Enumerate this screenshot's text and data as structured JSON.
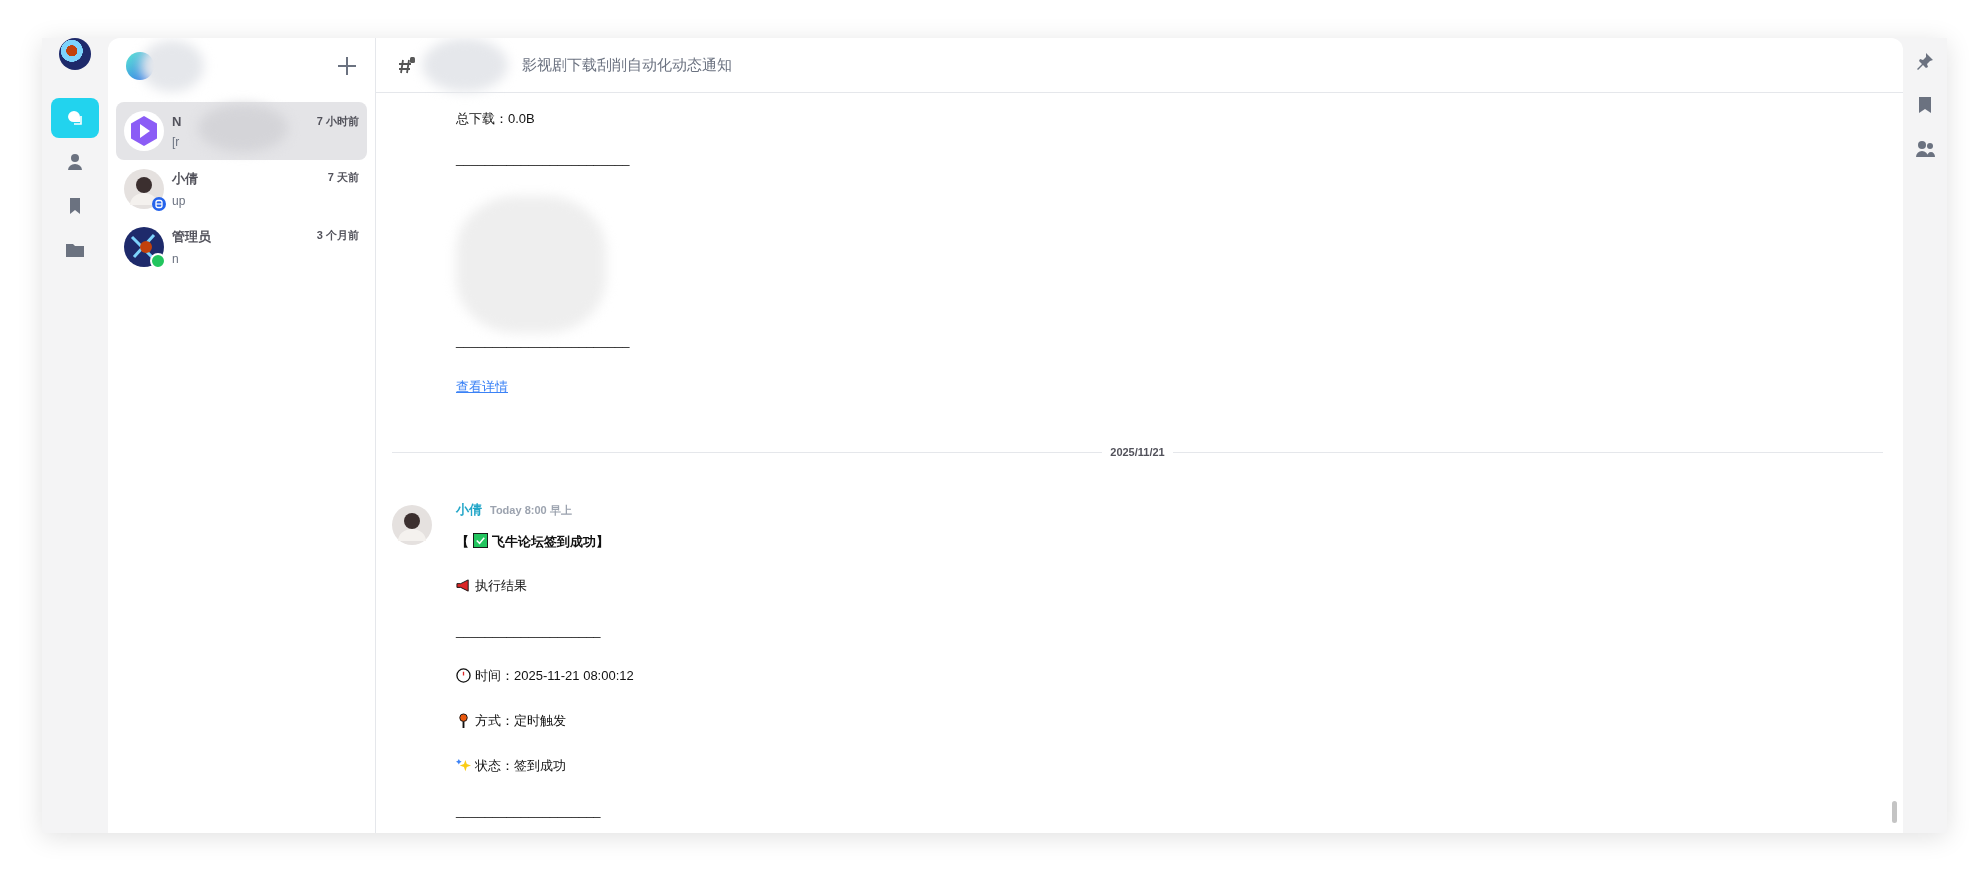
{
  "rail": {
    "items": [
      {
        "kind": "chats",
        "selected": true
      },
      {
        "kind": "contacts",
        "selected": false
      },
      {
        "kind": "bookmarks",
        "selected": false
      },
      {
        "kind": "files",
        "selected": false
      }
    ]
  },
  "channel_list": {
    "items": [
      {
        "name": "N",
        "preview": "[r",
        "time": "7 小时前",
        "kind": "channel",
        "selected": true
      },
      {
        "name": "小倩",
        "preview": "up",
        "time": "7 天前",
        "kind": "person",
        "bot": true,
        "selected": false
      },
      {
        "name": "管理员",
        "preview": "n",
        "time": "3 个月前",
        "kind": "art",
        "online": true,
        "selected": false
      }
    ]
  },
  "header": {
    "title": "影视剧下载刮削自动化动态通知"
  },
  "messages": [
    {
      "kind": "continued",
      "lines": [
        {
          "kind": "text",
          "text": "总下载：0.0B"
        },
        {
          "kind": "rule",
          "text": "________________________"
        },
        {
          "kind": "blurred"
        },
        {
          "kind": "rule",
          "text": "________________________"
        },
        {
          "kind": "link",
          "text": "查看详情"
        }
      ]
    },
    {
      "kind": "date",
      "text": "2025/11/21"
    },
    {
      "kind": "message",
      "author": "小倩",
      "time": "Today 8:00 早上",
      "lines": [
        {
          "kind": "title",
          "before": "【",
          "text": "飞牛论坛签到成功】"
        },
        {
          "kind": "result",
          "text": "执行结果"
        },
        {
          "kind": "rule",
          "text": "____________________"
        },
        {
          "kind": "time",
          "text": "时间：2025-11-21 08:00:12"
        },
        {
          "kind": "method",
          "text": "方式：定时触发"
        },
        {
          "kind": "status",
          "text": "状态：签到成功"
        },
        {
          "kind": "rule",
          "text": "____________________"
        }
      ]
    }
  ]
}
